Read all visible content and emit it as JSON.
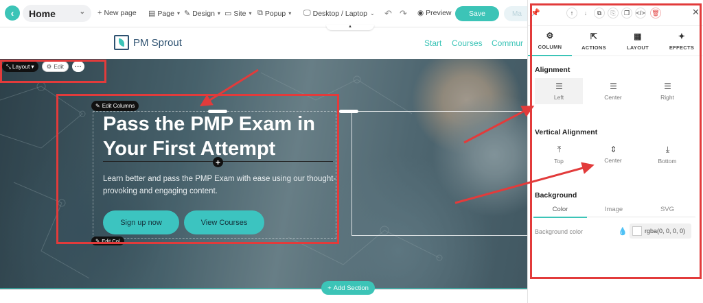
{
  "toolbar": {
    "page_name": "Home",
    "new_page": "New page",
    "page": "Page",
    "design": "Design",
    "site": "Site",
    "popup": "Popup",
    "device": "Desktop / Laptop",
    "preview": "Preview",
    "save": "Save",
    "more": "Ma"
  },
  "site": {
    "logo_text": "PM Sprout",
    "nav": [
      "Start",
      "Courses",
      "Commur"
    ]
  },
  "canvas": {
    "layout_label": "Layout",
    "edit_label": "Edit",
    "edit_columns": "Edit Columns",
    "edit_col": "Edit Col",
    "add_section": "Add Section"
  },
  "hero": {
    "title": "Pass the PMP Exam in Your First Attempt",
    "subtitle": "Learn better and pass the PMP Exam with ease using our thought-provoking and engaging content.",
    "btn_signup": "Sign up now",
    "btn_courses": "View Courses"
  },
  "panel": {
    "tabs": [
      "COLUMN",
      "ACTIONS",
      "LAYOUT",
      "EFFECTS"
    ],
    "alignment_title": "Alignment",
    "alignment": [
      "Left",
      "Center",
      "Right"
    ],
    "valign_title": "Vertical Alignment",
    "valign": [
      "Top",
      "Center",
      "Bottom"
    ],
    "background_title": "Background",
    "bg_tabs": [
      "Color",
      "Image",
      "SVG"
    ],
    "bg_color_label": "Background color",
    "bg_color_value": "rgba(0, 0, 0, 0)"
  },
  "colors": {
    "accent": "#3cc4b7",
    "annotation": "#e23b3b"
  }
}
